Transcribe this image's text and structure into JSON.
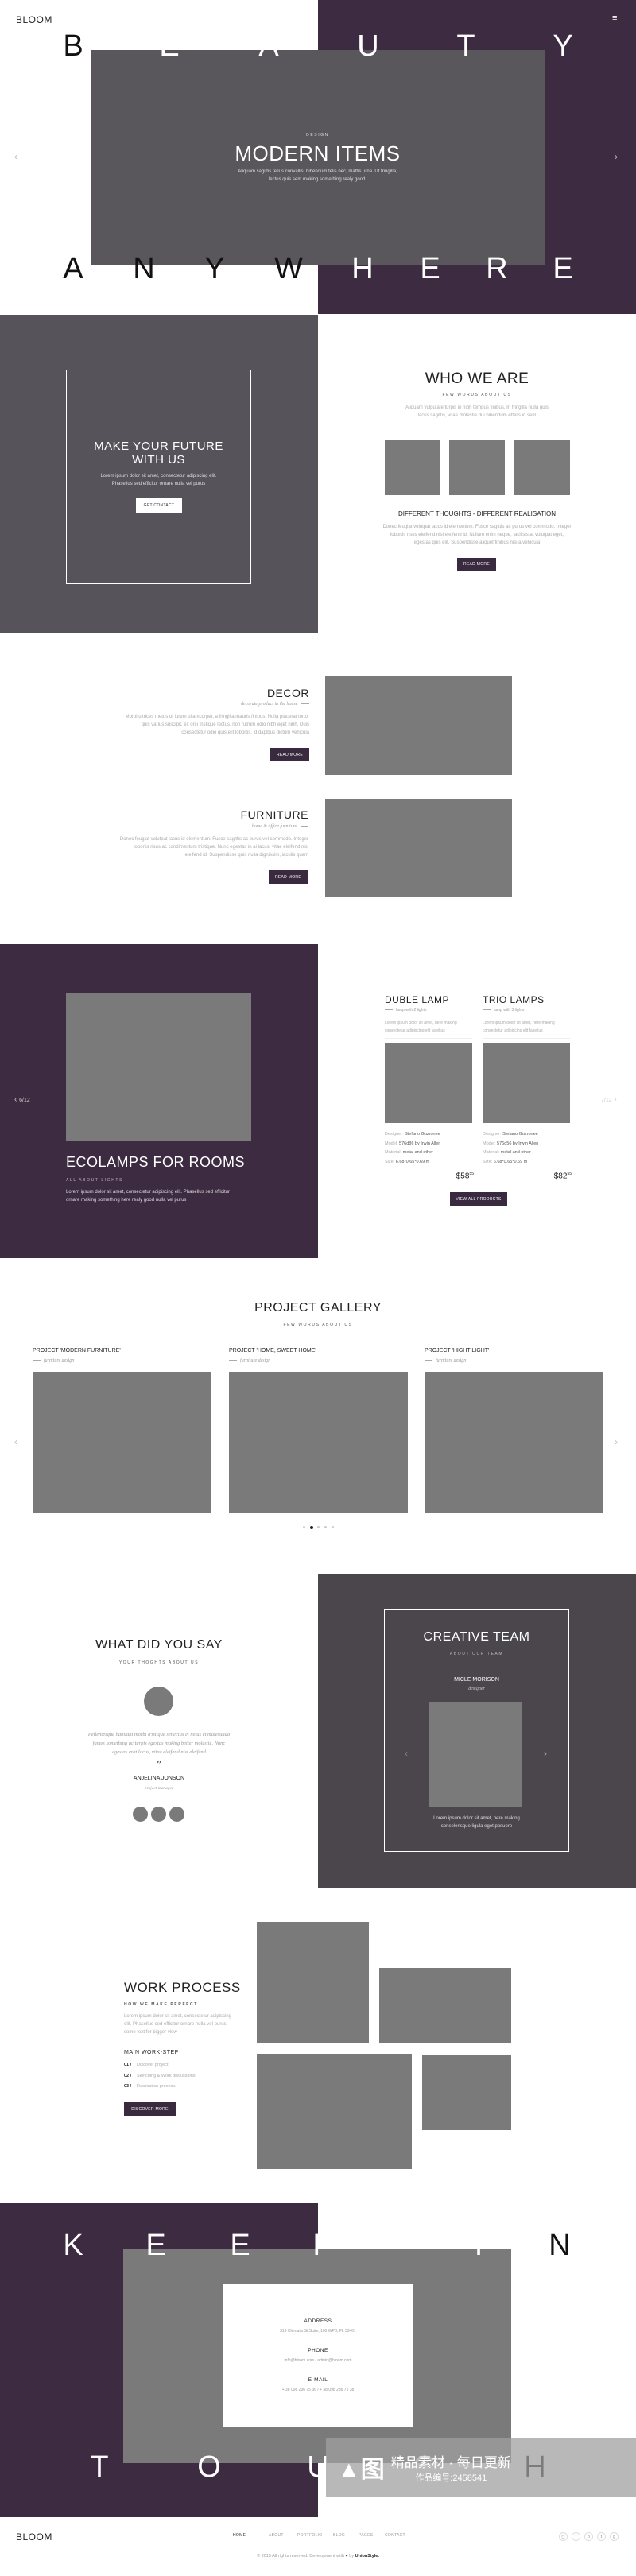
{
  "colors": {
    "purple": "#3d2b42",
    "dark_gray": "#57535a",
    "image_placeholder": "#7a7a7a",
    "button": "#3a2a3f"
  },
  "header": {
    "logo": "BLOOM",
    "menu_icon": "hamburger-icon"
  },
  "hero": {
    "top_word": [
      "B",
      "E",
      "A",
      "U",
      "T",
      "Y"
    ],
    "bottom_word": [
      "A",
      "N",
      "Y",
      "W",
      "H",
      "E",
      "R",
      "E"
    ],
    "eyebrow": "DESIGN",
    "title": "MODERN ITEMS",
    "text_line1": "Aliquam sagittis tellus convallis, bibendum felis nec, mattis urna. Ut fringilla,",
    "text_line2": "lectus quis sem making something realy good.",
    "prev_icon": "chevron-left-icon",
    "next_icon": "chevron-right-icon"
  },
  "future": {
    "title_line1": "MAKE YOUR FUTURE",
    "title_line2": "WITH US",
    "text_line1": "Lorem ipsum dolor sit amet, consectetur adipiscing elit.",
    "text_line2": "Phasellus sed efficitur  ornare nulla vel purus",
    "button": "GET CONTACT"
  },
  "who": {
    "title": "WHO WE ARE",
    "subtitle": "FEW WORDS ABOUT US",
    "text_line1": "Aliquam vulputate turpis in nibh tempus finibus. In fringilla nulla quis",
    "text_line2": "lacus sagittis, vitae molestie dui bibendum etfelis in sem",
    "heading": "DIFFERENT THOUGHTS - DIFFERENT REALISATION",
    "body_line1": "Donec feugiat volutpat lacus id elementum. Fusce sagittis ac purus vel commodo. Integer",
    "body_line2": "lobortis risus eleifend nisi eleifend id. Nullam enim neque, facilisis at volutpat eget,",
    "body_line3": "egestas quis elit. Suspendisse aliquet finibus nisi a vehicula",
    "button": "READ MORE"
  },
  "features": [
    {
      "title": "DECOR",
      "subtitle": "decorate product in the house",
      "lines": [
        "Morbi ultrices metus ut lorem ullamcorper, a fringilla mauris finibus. Nulla placerat tortor",
        "quis varius suscipit, ex orci tristique lectus, non rutrum odio nibh eget nibh. Duis",
        "consectetur odio quis elit lobortis, id dapibus dictum vehicula"
      ],
      "button": "READ MORE"
    },
    {
      "title": "FURNITURE",
      "subtitle": "home & affice furniture",
      "lines": [
        "Donec feugiat volutpat lacus id elementum. Fusce sagittis ac purus vel commodo. Integer",
        "lobortis risus ac condimentum tristique. Nunc egestas in ai lacus, vitae eleifend nisi",
        "eleifend id. Suspendisse quis nulla dignissim, iaculis quam"
      ],
      "button": "READ MORE"
    }
  ],
  "lamps": {
    "counter_left": "6/12",
    "counter_right": "7/12",
    "title": "ECOLAMPS FOR ROOMS",
    "subtitle": "ALL ABOUT LIGHTS",
    "text_line1": "Lorem ipsum dolor sit amet, consectetur adipiscing elit. Phasellus sed efficitur",
    "text_line2": "ornare making something here realy good nulla vel purus",
    "products": [
      {
        "name": "DUBLE LAMP",
        "subtitle": "lamp with 2 lights",
        "text_line1": "Lorem ipsum dolor sit amet, here making",
        "text_line2": "consectetur adipiscing elit fasellus",
        "designer_label": "Designer:",
        "designer": "Stefano Guzronee",
        "model_label": "Model:",
        "model": "576d86 by Irwin Allen",
        "material_label": "Material:",
        "material": "metal and other",
        "size_label": "Size:",
        "size": "6.68*0.65*0.69 m",
        "price": "$58",
        "cents": "55"
      },
      {
        "name": "TRIO LAMPS",
        "subtitle": "lamp with 3 lights",
        "text_line1": "Lorem ipsum dolor sit amet, here making",
        "text_line2": "consectetur adipiscing elit fasellus",
        "designer_label": "Designer:",
        "designer": "Stefano Guzronee",
        "model_label": "Model:",
        "model": "576d56 by Irwin Allen",
        "material_label": "Material:",
        "material": "metal and other",
        "size_label": "Size:",
        "size": "6.68*0.65*0.69 m",
        "price": "$82",
        "cents": "55"
      }
    ],
    "button": "VIEW ALL PRODUCTS"
  },
  "gallery": {
    "title": "PROJECT GALLERY",
    "subtitle": "FEW WORDS ABOUT US",
    "projects": [
      {
        "title": "PROJECT 'MODERN FURNITURE'",
        "subtitle": "furniture design"
      },
      {
        "title": "PROJECT 'HOME, SWEET HOME'",
        "subtitle": "furniture design"
      },
      {
        "title": "PROJECT 'HIGHT LIGHT'",
        "subtitle": "furniture design"
      }
    ],
    "pages": 5,
    "active_page": 2
  },
  "testimonials": {
    "title": "WHAT DID YOU SAY",
    "subtitle": "YOUR THOGHTS ABOUT US",
    "quote_line1": "Pellentesque habitant morbi tristique senectus et netus et malesuada",
    "quote_line2": "fames something ac turpis egestas making better molestie. Nunc",
    "quote_line3": "egestas erat lacus, vitae eleifend nisi eleifend",
    "quote_mark": "”",
    "name": "ANJELINA JONSON",
    "role": "project manager"
  },
  "team": {
    "title": "CREATIVE TEAM",
    "subtitle": "ABOUT OUR TEAM",
    "name": "MICLE MORISON",
    "role": "designer",
    "text_line1": "Lorem ipsum dolor sit amet, here making",
    "text_line2": "conselerisque ligula eget posuere"
  },
  "work": {
    "title": "WORK PROCESS",
    "subtitle": "HOW WE MAKE PERFECT",
    "text_line1": "Lorem ipsum dolor sit amet, consectetur adipiscing",
    "text_line2": "elit. Phasellus sed efficitur  ornare nulla vel purus",
    "text_line3": "some text for bigger view",
    "steps_title": "MAIN WORK-STEP",
    "steps": [
      {
        "num": "01 /",
        "label": "Discover project;"
      },
      {
        "num": "02 /",
        "label": "Sketching & Work discussions;"
      },
      {
        "num": "03 /",
        "label": "Realisation process."
      }
    ],
    "button": "DISCOVER MORE"
  },
  "contact": {
    "top_word": [
      "K",
      "E",
      "E",
      "P",
      "I",
      "N"
    ],
    "bottom_word": [
      "T",
      "O",
      "U",
      "C",
      "H"
    ],
    "address_label": "ADDRESS",
    "address": "319 Clematis St.Suite, 100 WPB, FL 33401",
    "phone_label": "PHONE",
    "phone": "info@bloom.com / admin@bloom.com",
    "email_label": "E-MAIL",
    "email": "+ 38 098 236 75 36 / + 38 098 236 75 38"
  },
  "watermark": {
    "text": "精品素材 · 每日更新",
    "id": "作品编号:2458541"
  },
  "footer": {
    "logo": "BLOOM",
    "nav": [
      "HOME",
      "ABOUT",
      "PORTFOLIO",
      "BLOG",
      "PAGES",
      "CONTACT"
    ],
    "social": [
      "instagram-icon",
      "facebook-icon",
      "pinterest-icon",
      "twitter-icon",
      "google-plus-icon"
    ],
    "copyright_pre": "© 2015 All rights reserved. Development with",
    "copyright_by": "by",
    "copyright_brand": "UnionStyle."
  }
}
